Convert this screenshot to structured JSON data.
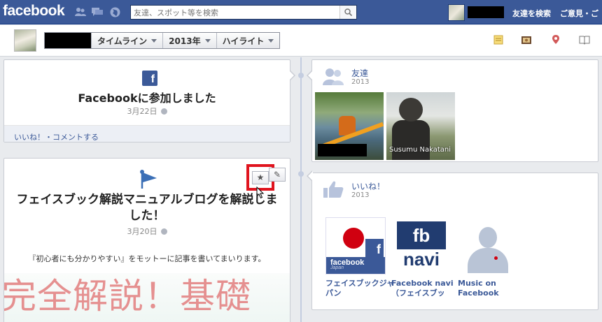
{
  "topbar": {
    "logo": "facebook",
    "search_placeholder": "友達、スポット等を検索",
    "find_friends": "友達を検索",
    "feedback": "ご意見・ご"
  },
  "header": {
    "scrubber": [
      {
        "label": "タイムライン"
      },
      {
        "label": "2013年"
      },
      {
        "label": "ハイライト"
      }
    ]
  },
  "event1": {
    "title": "Facebookに参加しました",
    "date": "3月22日",
    "footer": "いいね！・コメントする"
  },
  "event2": {
    "title": "フェイスブック解説マニュアルブログを解説しました！",
    "date": "3月20日",
    "text": "『初心者にも分かりやすい』をモットーに記事を書いてまいります。",
    "banner": "完全解説！基礎"
  },
  "friends": {
    "title": "友達",
    "year": "2013",
    "people": [
      {
        "name": ""
      },
      {
        "name": "Susumu Nakatani"
      }
    ]
  },
  "likes": {
    "title": "いいね！",
    "year": "2013",
    "pages": [
      {
        "name": "フェイスブックジャパン",
        "logo_text": "facebook",
        "logo_sub": "Japan"
      },
      {
        "name": "Facebook navi（フェイスブッ",
        "logo_top": "fb",
        "logo_bottom": "navi"
      },
      {
        "name": "Music on Facebook"
      }
    ]
  },
  "colors": {
    "brand": "#3b5998",
    "highlight_box": "#e0141e"
  }
}
